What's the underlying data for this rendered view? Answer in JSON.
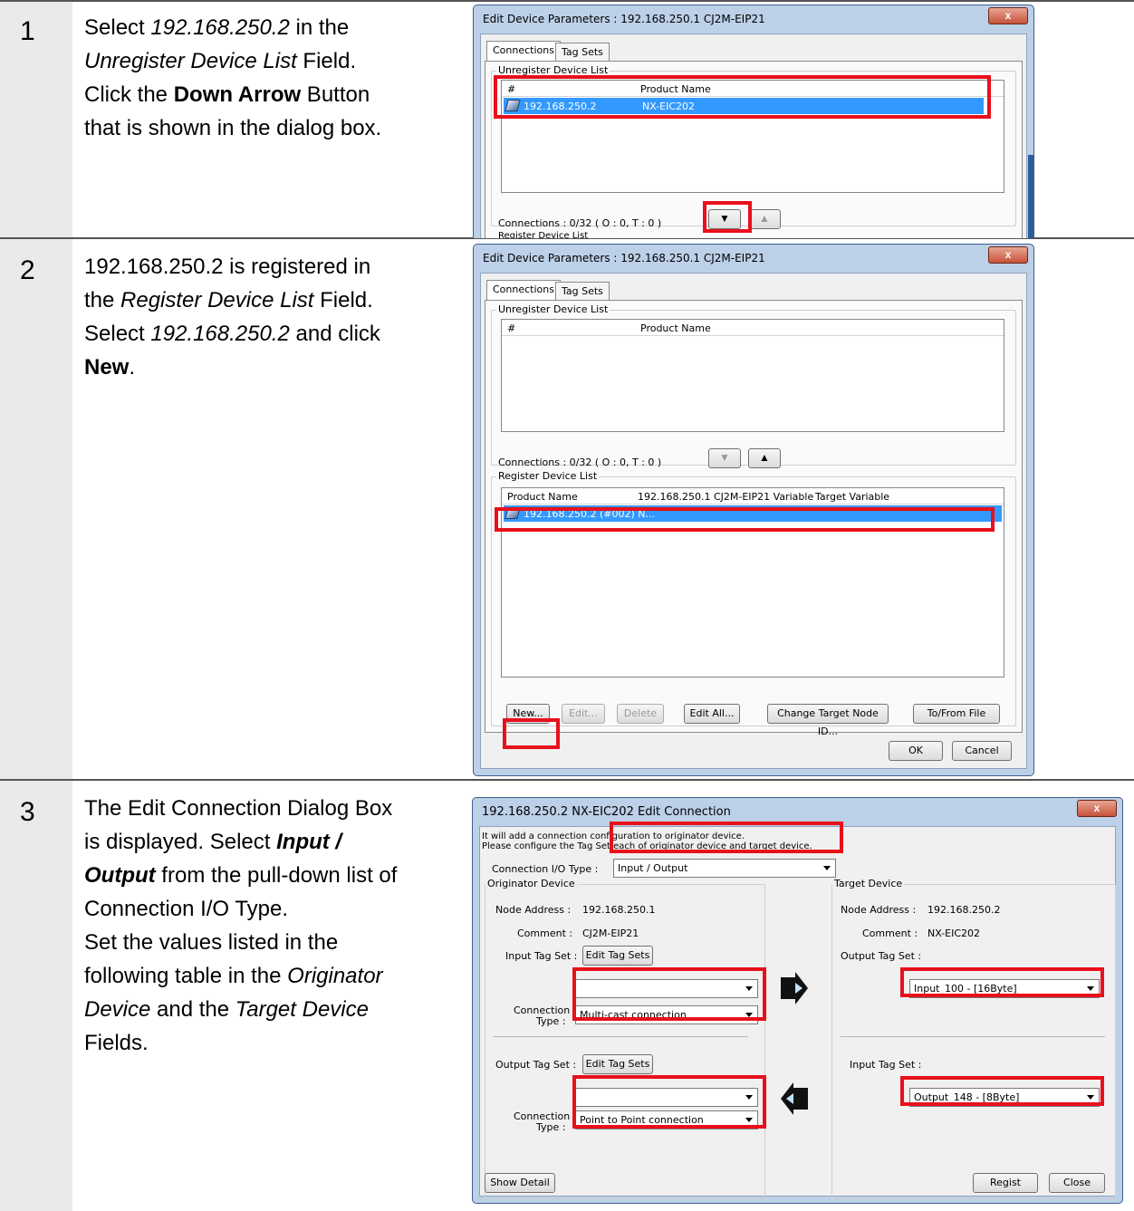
{
  "steps": [
    {
      "num": "1",
      "text": {
        "l1a": "Select ",
        "l1b": "192.168.250.2",
        "l1c": " in the",
        "l2a": "Unregister Device List",
        "l2b": " Field.",
        "l3a": "Click the ",
        "l3b": "Down Arrow",
        "l3c": " Button",
        "l4": "that is shown in the dialog box."
      },
      "dialog": {
        "title": "Edit Device Parameters : 192.168.250.1 CJ2M-EIP21",
        "close": "x",
        "tabs": [
          "Connections",
          "Tag Sets"
        ],
        "unregister_label": "Unregister Device List",
        "columns": [
          "#",
          "Product Name"
        ],
        "row": {
          "id": "192.168.250.2",
          "product": "NX-EIC202"
        },
        "connections": "Connections :  0/32 ( O : 0, T : 0 )",
        "register_label": "Register Device List"
      }
    },
    {
      "num": "2",
      "text": {
        "l1": "192.168.250.2 is registered in",
        "l2a": "the ",
        "l2b": "Register Device List",
        "l2c": " Field.",
        "l3a": "Select ",
        "l3b": "192.168.250.2",
        "l3c": " and click",
        "l4a": "New",
        "l4b": "."
      },
      "dialog": {
        "title": "Edit Device Parameters : 192.168.250.1 CJ2M-EIP21",
        "close": "x",
        "tabs": [
          "Connections",
          "Tag Sets"
        ],
        "unregister_label": "Unregister Device List",
        "columns": [
          "#",
          "Product Name"
        ],
        "connections": "Connections :  0/32 ( O : 0, T : 0 )",
        "register_label": "Register Device List",
        "reg_columns": [
          "Product Name",
          "192.168.250.1 CJ2M-EIP21 Variable",
          "Target Variable"
        ],
        "reg_row": "192.168.250.2 (#002) N...",
        "buttons": [
          "New...",
          "Edit...",
          "Delete",
          "Edit All...",
          "Change Target Node ID...",
          "To/From File"
        ],
        "ok": "OK",
        "cancel": "Cancel"
      }
    },
    {
      "num": "3",
      "text": {
        "l1": "The Edit Connection Dialog Box",
        "l2a": "is displayed. Select ",
        "l2b": "Input /",
        "l3a": "Output",
        "l3b": " from the pull-down list of",
        "l4": "Connection I/O Type.",
        "l5": "Set the values listed in the",
        "l6a": "following table in the ",
        "l6b": "Originator",
        "l7a": "Device",
        "l7b": " and the ",
        "l7c": "Target Device",
        "l8": "Fields."
      },
      "dialog": {
        "title": "192.168.250.2 NX-EIC202 Edit Connection",
        "close": "x",
        "intro1": "It will add a connection configuration to originator device.",
        "intro2": "Please configure the Tag Set each of originator device and target device.",
        "io_type_label": "Connection I/O Type :",
        "io_type_value": "Input / Output",
        "originator": {
          "label": "Originator Device",
          "node_label": "Node Address :",
          "node_value": "192.168.250.1",
          "comment_label": "Comment :",
          "comment_value": "CJ2M-EIP21",
          "input_tag_label": "Input Tag Set :",
          "edit_tag_sets": "Edit Tag Sets",
          "input_tag_value": "",
          "conn_type_label1": "Connection",
          "conn_type_label2": "Type :",
          "input_conn_type": "Multi-cast connection",
          "output_tag_label": "Output Tag Set :",
          "output_tag_value": "",
          "output_conn_type": "Point to Point connection"
        },
        "target": {
          "label": "Target Device",
          "node_label": "Node Address :",
          "node_value": "192.168.250.2",
          "comment_label": "Comment :",
          "comment_value": "NX-EIC202",
          "output_tag_label": "Output Tag Set :",
          "output_tag_value": "Input_100 - [16Byte]",
          "input_tag_label": "Input Tag Set :",
          "input_tag_value": "Output_148 - [8Byte]"
        },
        "show_detail": "Show Detail",
        "regist": "Regist",
        "close_btn": "Close"
      }
    }
  ]
}
